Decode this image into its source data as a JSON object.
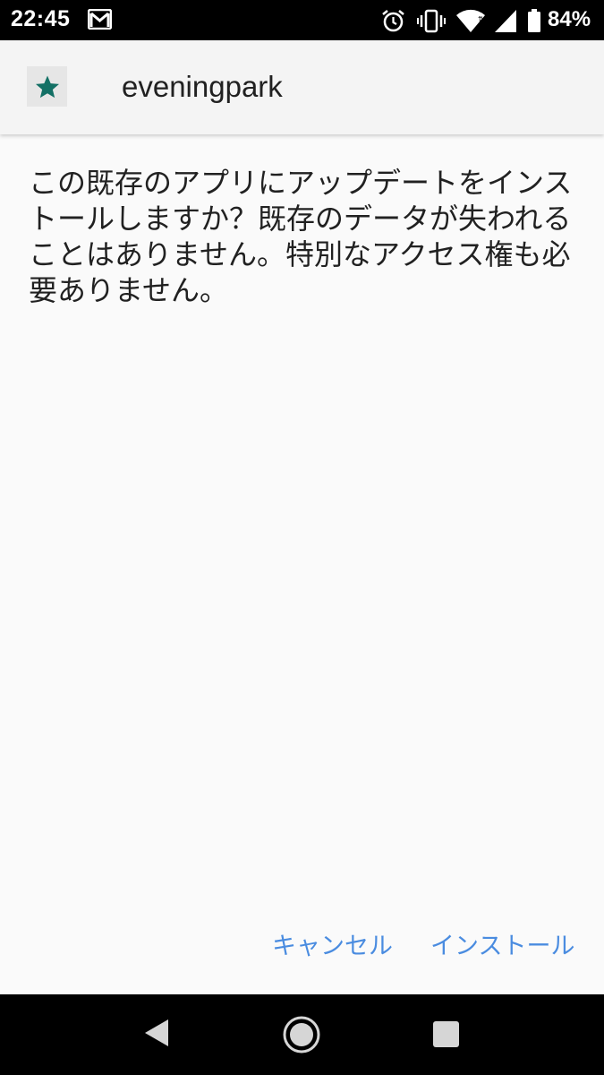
{
  "status_bar": {
    "time": "22:45",
    "battery": "84%",
    "icons": [
      "gmail-icon",
      "alarm-icon",
      "vibrate-icon",
      "wifi-icon",
      "signal-icon",
      "battery-icon"
    ]
  },
  "app_bar": {
    "title": "eveningpark",
    "icon": "star-icon",
    "icon_color": "#137065"
  },
  "dialog": {
    "message": "この既存のアプリにアップデートをインストールしますか？既存のデータが失われることはありません。特別なアクセス権も必要ありません。"
  },
  "actions": {
    "cancel_label": "キャンセル",
    "install_label": "インストール",
    "accent_color": "#4a8ce0"
  },
  "nav_bar": {
    "icons": [
      "back-icon",
      "home-icon",
      "recents-icon"
    ]
  }
}
